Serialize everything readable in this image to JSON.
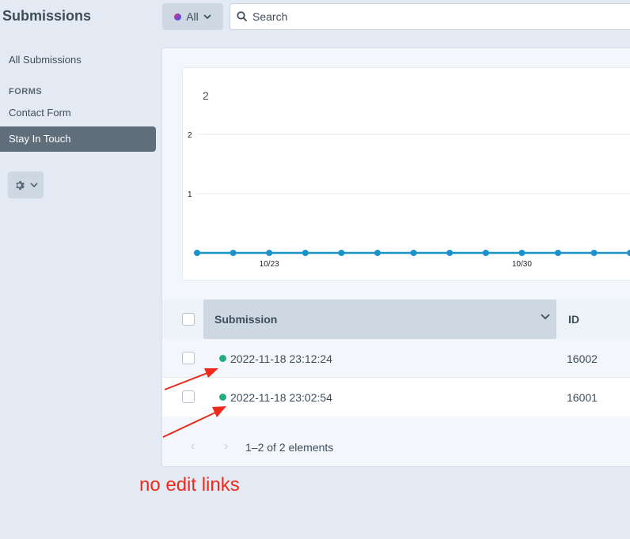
{
  "sidebar": {
    "title": "Submissions",
    "all_submissions": "All Submissions",
    "forms_heading": "FORMS",
    "items": [
      {
        "label": "Contact Form",
        "active": false
      },
      {
        "label": "Stay In Touch",
        "active": true
      }
    ],
    "settings_icon": "gear-icon"
  },
  "toolbar": {
    "site_filter_label": "All",
    "search_placeholder": "Search"
  },
  "chart_data": {
    "type": "line",
    "title": "2",
    "x_tick_labels": [
      "10/23",
      "10/30"
    ],
    "y_ticks": [
      1,
      2
    ],
    "ylim": [
      0,
      2
    ],
    "grid": true,
    "series": [
      {
        "values": [
          0,
          0,
          0,
          0,
          0,
          0,
          0,
          0,
          0,
          0,
          0,
          0,
          0
        ]
      }
    ],
    "line_color": "#1a92cc"
  },
  "table": {
    "columns": [
      "Submission",
      "ID"
    ],
    "rows": [
      {
        "date": "2022-11-18 23:12:24",
        "id": "16002",
        "status_color": "#27ab83"
      },
      {
        "date": "2022-11-18 23:02:54",
        "id": "16001",
        "status_color": "#27ab83"
      }
    ],
    "pagination": "1–2 of 2 elements"
  },
  "annotation": {
    "text": "no edit links",
    "color": "#ee2a1c"
  }
}
